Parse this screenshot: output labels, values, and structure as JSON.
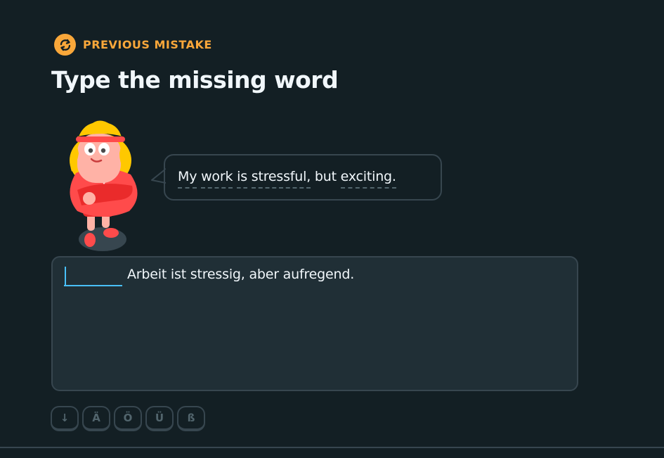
{
  "header": {
    "badge_icon": "refresh-icon",
    "badge_label": "PREVIOUS MISTAKE",
    "title": "Type the missing word"
  },
  "prompt": {
    "words": [
      "My",
      "work",
      "is",
      "stressful,",
      "but",
      "exciting."
    ],
    "trailing": ""
  },
  "answer": {
    "blank_value": "",
    "blank_placeholder": "",
    "rest_of_sentence": "Arbeit ist stressig, aber aufregend."
  },
  "keyboard": {
    "keys": [
      "↓",
      "Ä",
      "Ö",
      "Ü",
      "ß"
    ]
  },
  "colors": {
    "background": "#131f24",
    "accent_orange": "#f9a73a",
    "text": "#f1f7fb",
    "border": "#37464f",
    "input_blue": "#49c0f8",
    "character_red": "#ff4b4b"
  }
}
